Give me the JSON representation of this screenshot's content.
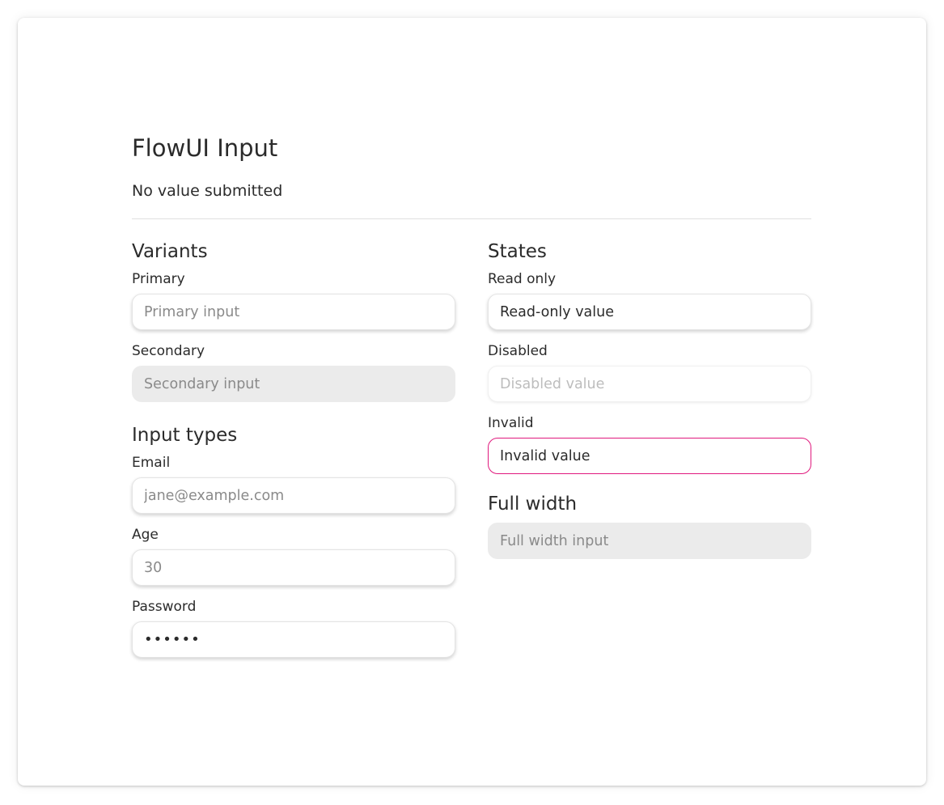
{
  "title": "FlowUI Input",
  "status": "No value submitted",
  "variants": {
    "heading": "Variants",
    "primary": {
      "label": "Primary",
      "placeholder": "Primary input"
    },
    "secondary": {
      "label": "Secondary",
      "placeholder": "Secondary input"
    }
  },
  "input_types": {
    "heading": "Input types",
    "email": {
      "label": "Email",
      "placeholder": "jane@example.com"
    },
    "age": {
      "label": "Age",
      "placeholder": "30"
    },
    "password": {
      "label": "Password",
      "value": "secret"
    }
  },
  "states": {
    "heading": "States",
    "read_only": {
      "label": "Read only",
      "value": "Read-only value"
    },
    "disabled": {
      "label": "Disabled",
      "placeholder": "Disabled value"
    },
    "invalid": {
      "label": "Invalid",
      "value": "Invalid value"
    }
  },
  "full_width": {
    "heading": "Full width",
    "placeholder": "Full width input"
  },
  "colors": {
    "invalid_border": "#e0197d",
    "secondary_bg": "#ebebeb"
  }
}
